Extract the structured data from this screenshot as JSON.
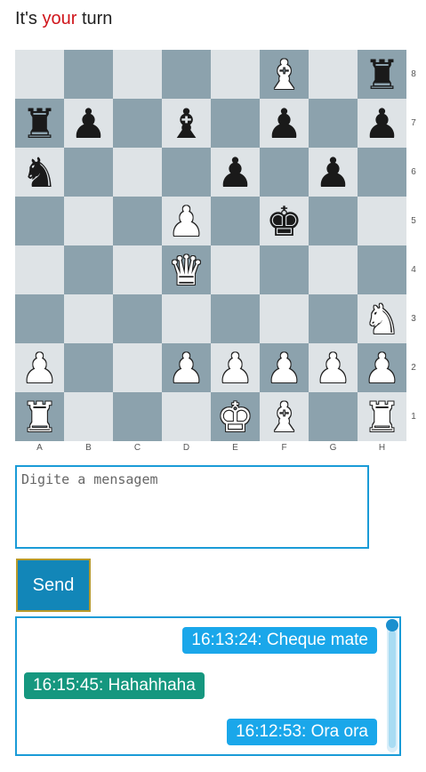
{
  "header": {
    "prefix": "It's ",
    "highlight": "your",
    "suffix": " turn",
    "highlight_color": "#d0151b"
  },
  "board": {
    "colors": {
      "light": "#dee3e6",
      "dark": "#8ca2ad"
    },
    "files": [
      "A",
      "B",
      "C",
      "D",
      "E",
      "F",
      "G",
      "H"
    ],
    "ranks": [
      "8",
      "7",
      "6",
      "5",
      "4",
      "3",
      "2",
      "1"
    ],
    "position": [
      [
        "",
        "",
        "",
        "",
        "",
        "wB",
        "",
        "bR"
      ],
      [
        "bR",
        "bP",
        "",
        "bB",
        "",
        "bP",
        "",
        "bP"
      ],
      [
        "bN",
        "",
        "",
        "",
        "bP",
        "",
        "bP",
        ""
      ],
      [
        "",
        "",
        "",
        "wP",
        "",
        "bK",
        "",
        ""
      ],
      [
        "",
        "",
        "",
        "wQ",
        "",
        "",
        "",
        ""
      ],
      [
        "",
        "",
        "",
        "",
        "",
        "",
        "",
        "wN"
      ],
      [
        "wP",
        "",
        "",
        "wP",
        "wP",
        "wP",
        "wP",
        "wP"
      ],
      [
        "wR",
        "",
        "",
        "",
        "wK",
        "wB",
        "",
        "wR"
      ]
    ]
  },
  "chat": {
    "input_placeholder": "Digite a mensagem",
    "input_value": "",
    "send_label": "Send",
    "send_color": "#1286b8",
    "messages": [
      {
        "text": "16:13:24: Cheque mate",
        "side": "mine",
        "color": "#1aa7ea"
      },
      {
        "text": "16:15:45: Hahahhaha",
        "side": "theirs",
        "color": "#15977f"
      },
      {
        "text": "16:12:53: Ora ora",
        "side": "mine",
        "color": "#1aa7ea"
      }
    ]
  }
}
